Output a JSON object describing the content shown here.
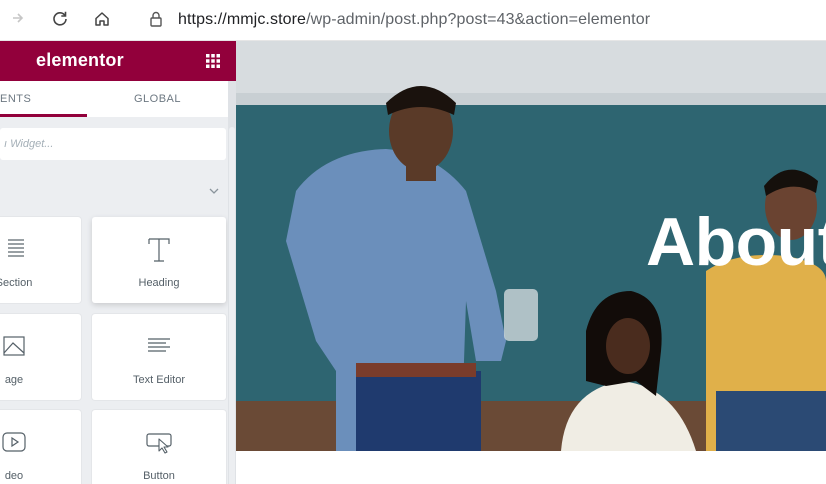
{
  "browser": {
    "url_domain": "https://mmjc.store",
    "url_path": "/wp-admin/post.php?post=43&action=elementor",
    "icons": [
      "forward-icon",
      "reload-icon",
      "home-icon",
      "lock-icon"
    ]
  },
  "panel": {
    "brand": "elementor",
    "tabs": [
      {
        "label": "ENTS",
        "active": true
      },
      {
        "label": "GLOBAL",
        "active": false
      }
    ],
    "search_placeholder": "ı Widget...",
    "widgets": [
      {
        "label": "Section",
        "icon": "section-icon"
      },
      {
        "label": "Heading",
        "icon": "heading-icon"
      },
      {
        "label": "age",
        "icon": "image-icon"
      },
      {
        "label": "Text Editor",
        "icon": "text-editor-icon"
      },
      {
        "label": "deo",
        "icon": "video-icon"
      },
      {
        "label": "Button",
        "icon": "button-icon"
      }
    ],
    "accent_color": "#92003b"
  },
  "canvas": {
    "hero_title": "About"
  }
}
